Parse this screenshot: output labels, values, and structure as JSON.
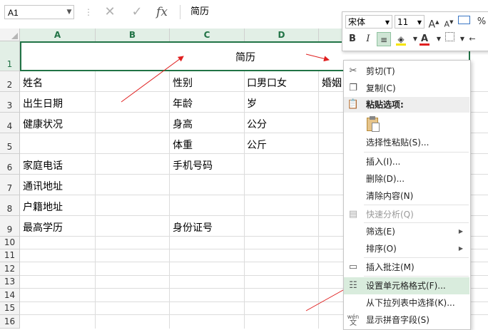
{
  "formula_bar": {
    "name_box": "A1",
    "formula": "简历",
    "cancel_icon": "✕",
    "enter_icon": "✓",
    "fx_icon": "fx"
  },
  "columns": [
    "A",
    "B",
    "C",
    "D"
  ],
  "rows": [
    "1",
    "2",
    "3",
    "4",
    "5",
    "6",
    "7",
    "8",
    "9",
    "10",
    "11",
    "12",
    "13",
    "14",
    "15",
    "16"
  ],
  "sheet": {
    "title": "简历",
    "cells": {
      "A2": "姓名",
      "C2": "性别",
      "D2": "口男口女",
      "E2": "婚姻",
      "A3": "出生日期",
      "C3": "年龄",
      "D3": "岁",
      "A4": "健康状况",
      "C4": "身高",
      "D4": "公分",
      "C5": "体重",
      "D5": "公斤",
      "A6": "家庭电话",
      "C6": "手机号码",
      "A7": "通讯地址",
      "A8": "户籍地址",
      "A9": "最高学历",
      "C9": "身份证号"
    }
  },
  "mini_toolbar": {
    "font_name": "宋体",
    "font_size": "11",
    "grow_font": "A",
    "shrink_font": "A",
    "percent": "%",
    "bold": "B",
    "italic": "I",
    "font_color_letter": "A",
    "accent_red": "#e02020",
    "accent_yellow": "#f5e400"
  },
  "context_menu": {
    "items": [
      {
        "label": "剪切(T)",
        "icon": "scissors-icon"
      },
      {
        "label": "复制(C)",
        "icon": "copy-icon"
      },
      {
        "label": "粘贴选项:",
        "icon": "paste-icon"
      },
      {
        "label": "选择性粘贴(S)...",
        "icon": ""
      },
      {
        "label": "插入(I)...",
        "icon": ""
      },
      {
        "label": "删除(D)...",
        "icon": ""
      },
      {
        "label": "清除内容(N)",
        "icon": ""
      },
      {
        "label": "快速分析(Q)",
        "icon": "quick-analysis-icon"
      },
      {
        "label": "筛选(E)",
        "icon": ""
      },
      {
        "label": "排序(O)",
        "icon": ""
      },
      {
        "label": "插入批注(M)",
        "icon": "comment-icon"
      },
      {
        "label": "设置单元格格式(F)...",
        "icon": "format-cells-icon"
      },
      {
        "label": "从下拉列表中选择(K)...",
        "icon": ""
      },
      {
        "label": "显示拼音字段(S)",
        "icon": "phonetic-icon"
      }
    ],
    "phonetic_icon_text": "wén",
    "highlight_color": "#d9ecdd"
  },
  "annotations": {
    "arrow_color": "#e02020"
  }
}
